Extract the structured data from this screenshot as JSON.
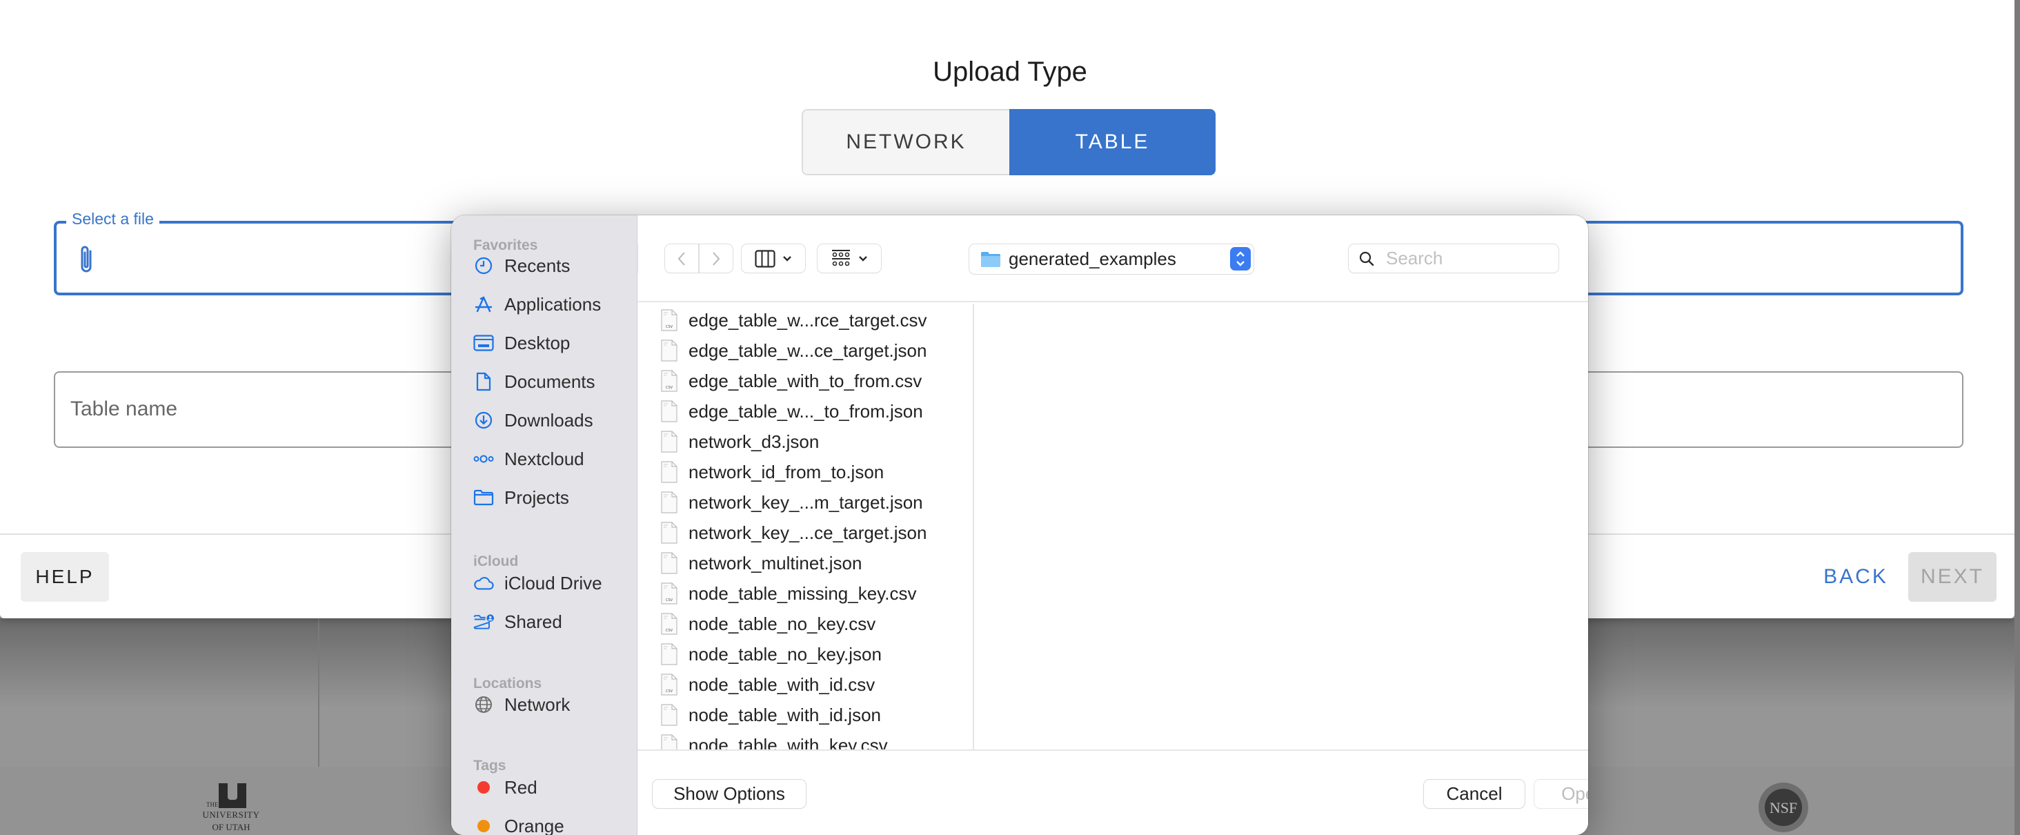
{
  "app": {
    "title": "Upload Type",
    "upload_types": [
      {
        "label": "NETWORK",
        "selected": false
      },
      {
        "label": "TABLE",
        "selected": true
      }
    ],
    "file_field": {
      "label": "Select a file",
      "value": ""
    },
    "table_name_field": {
      "placeholder": "Table name",
      "value": ""
    },
    "footer": {
      "help": "HELP",
      "back": "BACK",
      "next": "NEXT"
    },
    "colors": {
      "accent": "#3874cb",
      "disabled": "#e0e0e0"
    }
  },
  "background_page": {
    "logos": [
      "university-of-utah-logo",
      "nsf-logo"
    ],
    "utah_logo_text": {
      "the": "THE",
      "university": "UNIVERSITY",
      "of_utah": "OF UTAH"
    }
  },
  "file_picker": {
    "sidebar": {
      "sections": [
        {
          "title": "Favorites",
          "items": [
            {
              "label": "Recents",
              "icon": "clock-icon"
            },
            {
              "label": "Applications",
              "icon": "applications-icon"
            },
            {
              "label": "Desktop",
              "icon": "desktop-icon"
            },
            {
              "label": "Documents",
              "icon": "document-icon"
            },
            {
              "label": "Downloads",
              "icon": "download-icon"
            },
            {
              "label": "Nextcloud",
              "icon": "nextcloud-icon"
            },
            {
              "label": "Projects",
              "icon": "folder-icon"
            }
          ]
        },
        {
          "title": "iCloud",
          "items": [
            {
              "label": "iCloud Drive",
              "icon": "cloud-icon"
            },
            {
              "label": "Shared",
              "icon": "shared-folder-icon"
            }
          ]
        },
        {
          "title": "Locations",
          "items": [
            {
              "label": "Network",
              "icon": "globe-icon"
            }
          ]
        },
        {
          "title": "Tags",
          "items": [
            {
              "label": "Red",
              "icon": "tag-dot-icon",
              "color": "#f43b30"
            },
            {
              "label": "Orange",
              "icon": "tag-dot-icon",
              "color": "#f0900f"
            }
          ]
        }
      ]
    },
    "toolbar": {
      "back": "back",
      "forward": "forward",
      "view_mode": "column-view",
      "group_mode": "grid-view",
      "current_folder": "generated_examples",
      "search_placeholder": "Search"
    },
    "files": [
      {
        "name": "edge_table_w...rce_target.csv",
        "type": "csv"
      },
      {
        "name": "edge_table_w...ce_target.json",
        "type": "json"
      },
      {
        "name": "edge_table_with_to_from.csv",
        "type": "csv"
      },
      {
        "name": "edge_table_w..._to_from.json",
        "type": "json"
      },
      {
        "name": "network_d3.json",
        "type": "json"
      },
      {
        "name": "network_id_from_to.json",
        "type": "json"
      },
      {
        "name": "network_key_...m_target.json",
        "type": "json"
      },
      {
        "name": "network_key_...ce_target.json",
        "type": "json"
      },
      {
        "name": "network_multinet.json",
        "type": "json"
      },
      {
        "name": "node_table_missing_key.csv",
        "type": "csv"
      },
      {
        "name": "node_table_no_key.csv",
        "type": "csv"
      },
      {
        "name": "node_table_no_key.json",
        "type": "json"
      },
      {
        "name": "node_table_with_id.csv",
        "type": "csv"
      },
      {
        "name": "node_table_with_id.json",
        "type": "json"
      },
      {
        "name": "node_table_with_key.csv",
        "type": "csv"
      }
    ],
    "footer": {
      "show_options": "Show Options",
      "cancel": "Cancel",
      "open": "Open",
      "open_enabled": false
    }
  }
}
